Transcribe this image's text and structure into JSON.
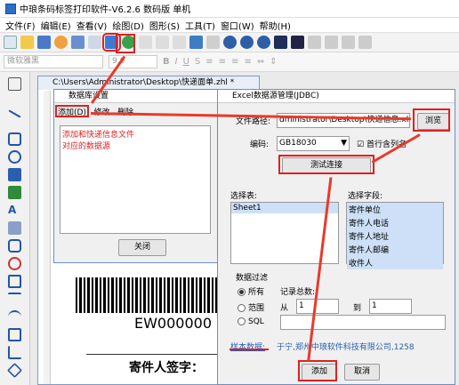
{
  "app": {
    "title": "中琅条码标签打印软件-V6.2.6 数码版 单机"
  },
  "menu": [
    "文件(F)",
    "编辑(E)",
    "查看(V)",
    "绘图(D)",
    "图形(S)",
    "工具(T)",
    "窗口(W)",
    "帮助(H)"
  ],
  "font_toolbar": {
    "font_placeholder": "微软雅黑",
    "size_value": "9.0"
  },
  "document": {
    "title": "C:\\Users\\Administrator\\Desktop\\快递面单.zhl *",
    "barcode_text": "EW000000",
    "signature_label": "寄件人签字："
  },
  "datasource_dialog": {
    "title": "数据库设置",
    "menu_add": "添加(D)",
    "menu_modify": "修改",
    "menu_delete": "删除",
    "note": "添加和快递信息文件\n对应的数据源",
    "close_label": "关闭"
  },
  "excel_dialog": {
    "title": "Excel数据源管理(JDBC)",
    "file_path_label": "文件路径:",
    "file_path_value": "dministrator\\Desktop\\快递信息.xlsx",
    "browse_label": "浏览",
    "encoding_label": "编码:",
    "encoding_value": "GB18030",
    "first_row_label": "首行含列名",
    "test_label": "测试连接",
    "select_table_label": "选择表:",
    "select_field_label": "选择字段:",
    "tables": [
      "Sheet1"
    ],
    "fields": [
      "寄件单位",
      "寄件人电话",
      "寄件人地址",
      "寄件人邮编",
      "收件人"
    ],
    "filter_label": "数据过滤",
    "opt_all": "所有",
    "record_total_label": "记录总数:",
    "opt_range": "范围",
    "from_label": "从",
    "from_value": "1",
    "to_label": "到",
    "to_value": "1",
    "opt_sql": "SQL",
    "sample_label": "样本数据:",
    "sample_value": "于宁,郑州中琅软件科技有限公司,1258",
    "add_label": "添加",
    "cancel_label": "取消"
  }
}
